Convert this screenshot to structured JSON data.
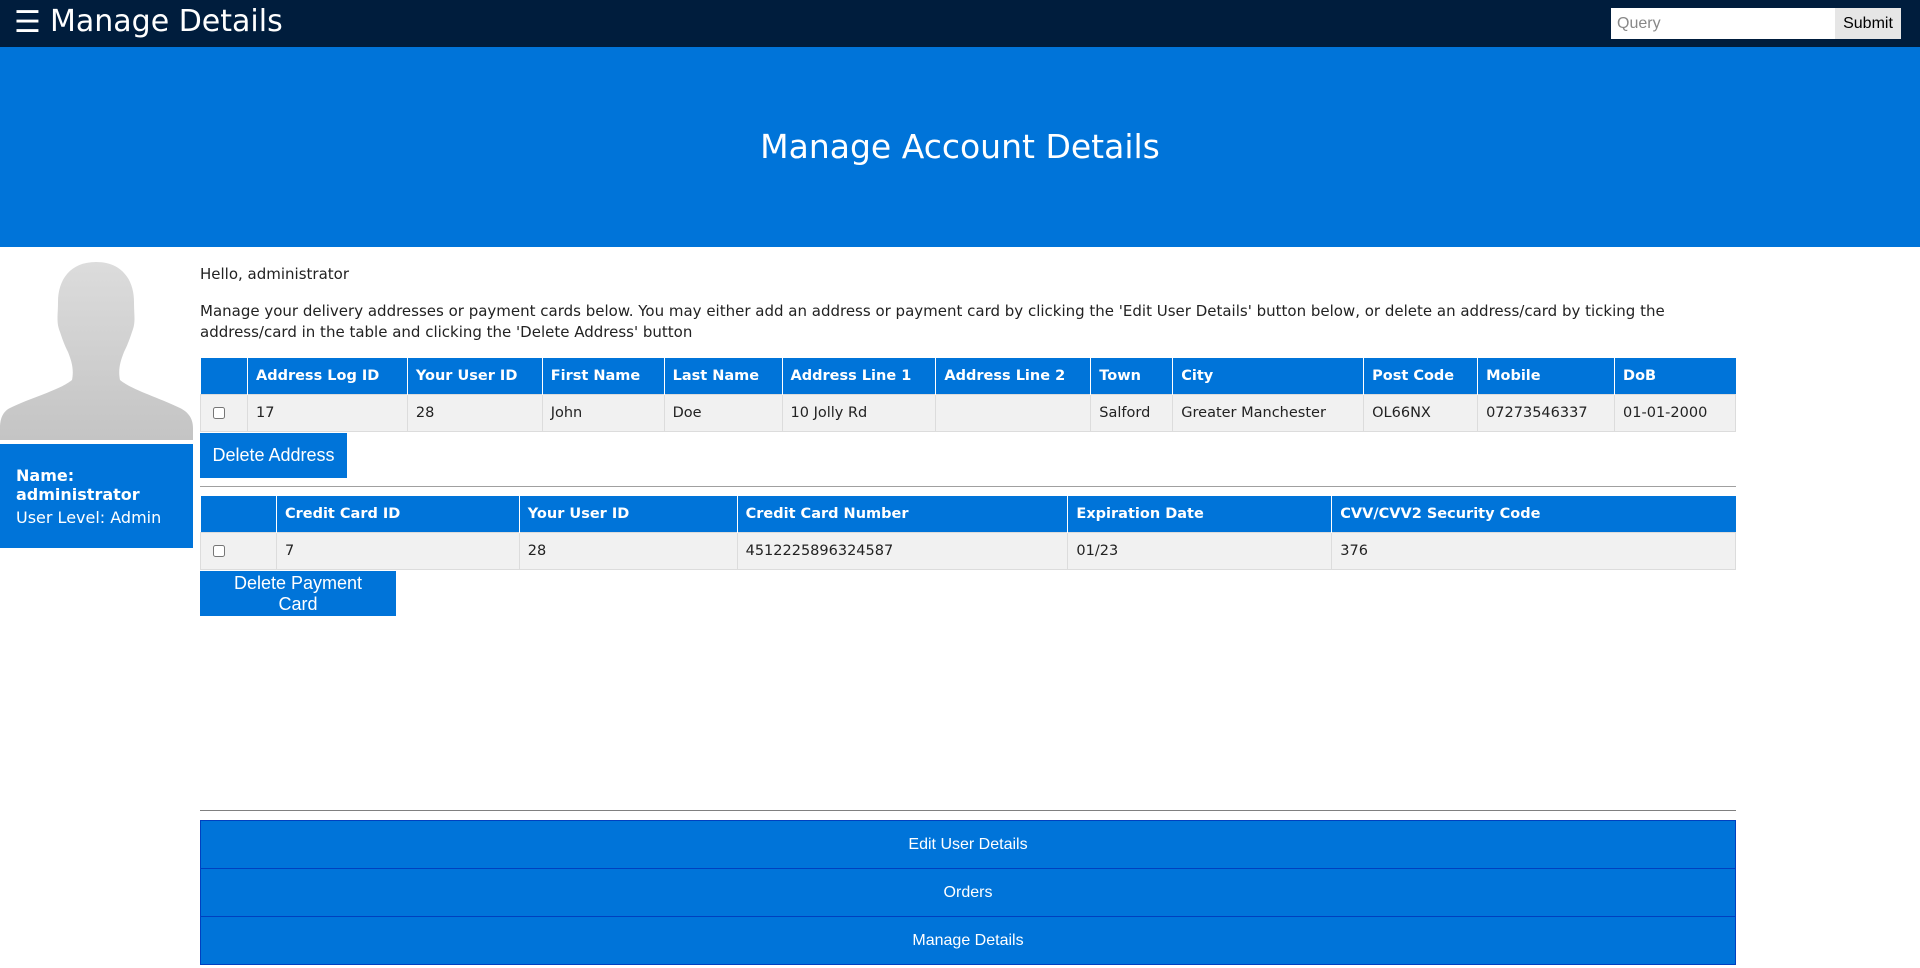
{
  "topbar": {
    "menu_icon": "☰",
    "title": "Manage Details",
    "search_placeholder": "Query",
    "search_value": "",
    "submit_label": "Submit"
  },
  "hero": {
    "title": "Manage Account Details"
  },
  "sidebar": {
    "name_label": "Name: administrator",
    "level_label": "User Level: Admin"
  },
  "main": {
    "greeting": "Hello, administrator",
    "intro": "Manage your delivery addresses or payment cards below. You may either add an address or payment card by clicking the 'Edit User Details' button below, or delete an address/card by ticking the address/card in the table and clicking the 'Delete Address' button"
  },
  "address_table": {
    "headers": [
      "",
      "Address Log ID",
      "Your User ID",
      "First Name",
      "Last Name",
      "Address Line 1",
      "Address Line 2",
      "Town",
      "City",
      "Post Code",
      "Mobile",
      "DoB"
    ],
    "rows": [
      {
        "address_log_id": "17",
        "user_id": "28",
        "first_name": "John",
        "last_name": "Doe",
        "line1": "10 Jolly Rd",
        "line2": "",
        "town": "Salford",
        "city": "Greater Manchester",
        "post_code": "OL66NX",
        "mobile": "07273546337",
        "dob": "01-01-2000"
      }
    ],
    "delete_label": "Delete Address"
  },
  "card_table": {
    "headers": [
      "",
      "Credit Card ID",
      "Your User ID",
      "Credit Card Number",
      "Expiration Date",
      "CVV/CVV2 Security Code"
    ],
    "rows": [
      {
        "card_id": "7",
        "user_id": "28",
        "number": "4512225896324587",
        "expiry": "01/23",
        "cvv": "376"
      }
    ],
    "delete_label": "Delete Payment Card"
  },
  "nav": {
    "edit_label": "Edit User Details",
    "orders_label": "Orders",
    "manage_label": "Manage Details"
  },
  "colors": {
    "topbar": "#001d3d",
    "accent": "#0074d9",
    "row_bg": "#f1f1f1"
  }
}
